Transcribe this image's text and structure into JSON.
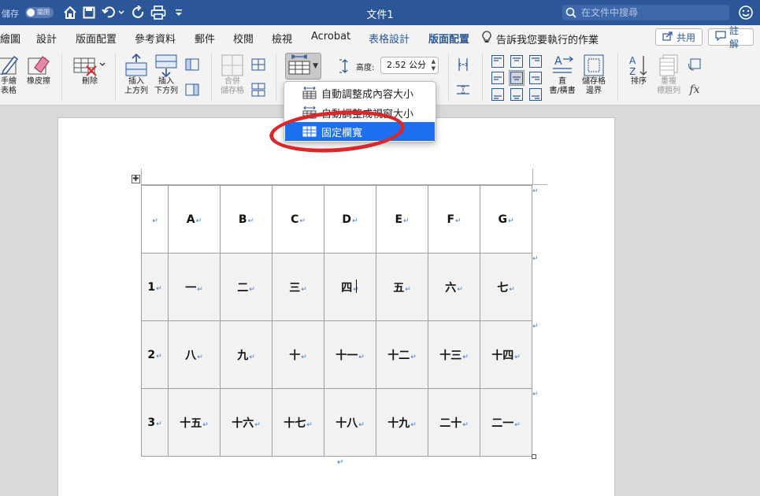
{
  "titlebar": {
    "autosave_label": "儲存",
    "autosave_state": "關閉",
    "document_title": "文件1",
    "search_placeholder": "在文件中搜尋",
    "icons": [
      "home-icon",
      "save-icon",
      "undo-icon",
      "redo-icon",
      "print-icon",
      "customize-toolbar-icon",
      "search-icon",
      "smiley-feedback-icon"
    ]
  },
  "tabs": [
    {
      "label": "繪圖",
      "state": "normal"
    },
    {
      "label": "設計",
      "state": "normal"
    },
    {
      "label": "版面配置",
      "state": "normal"
    },
    {
      "label": "參考資料",
      "state": "normal"
    },
    {
      "label": "郵件",
      "state": "normal"
    },
    {
      "label": "校閱",
      "state": "normal"
    },
    {
      "label": "檢視",
      "state": "normal"
    },
    {
      "label": "Acrobat",
      "state": "normal"
    },
    {
      "label": "表格設計",
      "state": "contextual"
    },
    {
      "label": "版面配置",
      "state": "active"
    }
  ],
  "tell_me": "告訴我您要執行的作業",
  "share_label": "共用",
  "comments_label": "註解",
  "ribbon": {
    "draw_table": "手繪\n表格",
    "eraser": "橡皮擦",
    "delete": "刪除",
    "insert_above": "插入\n上方列",
    "insert_below": "插入\n下方列",
    "merge_cells": "合併\n儲存格",
    "height_label": "高度:",
    "height_value": "2.52 公分",
    "text_direction": "直\n書/橫書",
    "cell_margins": "儲存格\n邊界",
    "sort": "排序",
    "repeat_header": "重複\n標題列",
    "formula_symbol": "fx"
  },
  "autofit_menu": {
    "items": [
      {
        "label": "自動調整成內容大小",
        "selected": false
      },
      {
        "label": "自動調整成視窗大小",
        "selected": false
      },
      {
        "label": "固定欄寬",
        "selected": true
      }
    ]
  },
  "table": {
    "rows": [
      [
        "",
        "A",
        "B",
        "C",
        "D",
        "E",
        "F",
        "G"
      ],
      [
        "1",
        "一",
        "二",
        "三",
        "四",
        "五",
        "六",
        "七"
      ],
      [
        "2",
        "八",
        "九",
        "十",
        "十一",
        "十二",
        "十三",
        "十四"
      ],
      [
        "3",
        "十五",
        "十六",
        "十七",
        "十八",
        "十九",
        "二十",
        "二一"
      ]
    ]
  },
  "colors": {
    "titlebar": "#2b579a",
    "accent": "#2b579a",
    "menu_selection": "#1e6ff1",
    "annotation_circle": "#d9282a",
    "paragraph_mark": "#3b7bd9"
  }
}
